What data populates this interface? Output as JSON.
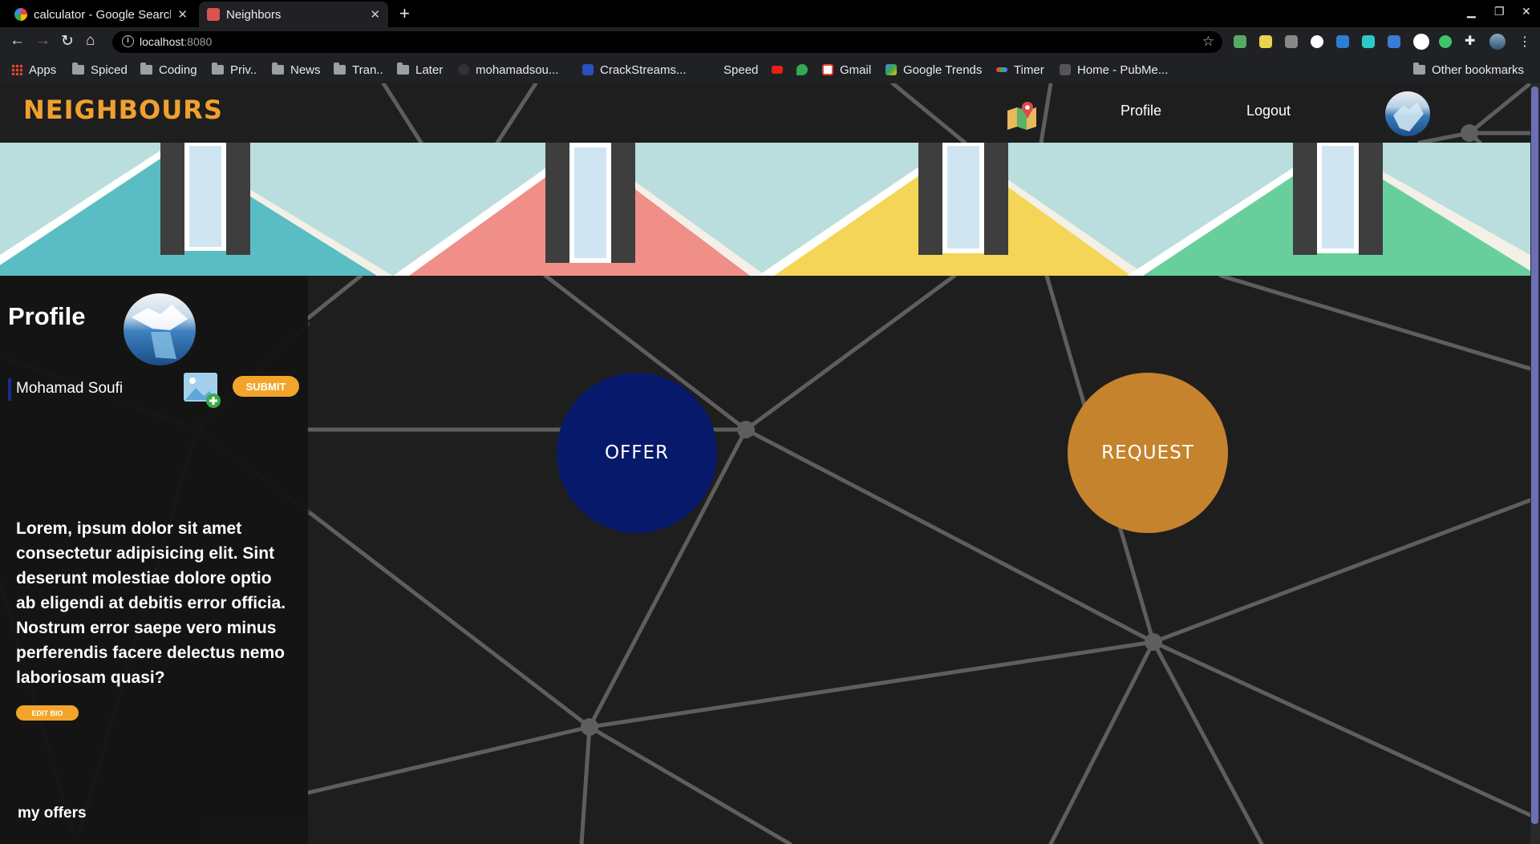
{
  "browser": {
    "tabs": [
      {
        "title": "calculator - Google Search",
        "active": false
      },
      {
        "title": "Neighbors",
        "active": true
      }
    ],
    "address": {
      "host": "localhost",
      "port": ":8080"
    },
    "bookmarks": [
      {
        "label": "Apps",
        "icon": "apps-grid-icon"
      },
      {
        "label": "Spiced",
        "icon": "folder-icon"
      },
      {
        "label": "Coding",
        "icon": "folder-icon"
      },
      {
        "label": "Priv..",
        "icon": "folder-icon"
      },
      {
        "label": "News",
        "icon": "folder-icon"
      },
      {
        "label": "Tran..",
        "icon": "folder-icon"
      },
      {
        "label": "Later",
        "icon": "folder-icon"
      },
      {
        "label": "mohamadsou...",
        "icon": "github-icon"
      },
      {
        "label": "CrackStreams...",
        "icon": "site-icon"
      },
      {
        "label": "Speed",
        "icon": "none"
      },
      {
        "label": "",
        "icon": "youtube-icon"
      },
      {
        "label": "",
        "icon": "maps-icon"
      },
      {
        "label": "Gmail",
        "icon": "gmail-icon"
      },
      {
        "label": "Google Trends",
        "icon": "trends-icon"
      },
      {
        "label": "Timer",
        "icon": "timer-icon"
      },
      {
        "label": "Home - PubMe...",
        "icon": "pubmed-icon"
      },
      {
        "label": "Other bookmarks",
        "icon": "folder-icon"
      }
    ]
  },
  "header": {
    "logo": "NEIGHBOURS",
    "nav": {
      "profile": "Profile",
      "logout": "Logout"
    }
  },
  "sidebar": {
    "title": "Profile",
    "name": "Mohamad Soufi",
    "submit_label": "SUBMIT",
    "bio": "Lorem, ipsum dolor sit amet consectetur adipisicing elit. Sint deserunt molestiae dolore optio ab eligendi at debitis error officia. Nostrum error saepe vero minus perferendis facere delectus nemo laboriosam quasi?",
    "edit_bio_label": "EDIT BIO",
    "my_offers": "my offers"
  },
  "main": {
    "offer_label": "OFFER",
    "request_label": "REQUEST"
  },
  "colors": {
    "accent": "#f2a52a",
    "offer": "#07196a",
    "request": "#c5832e",
    "background": "#1e1e1e"
  }
}
